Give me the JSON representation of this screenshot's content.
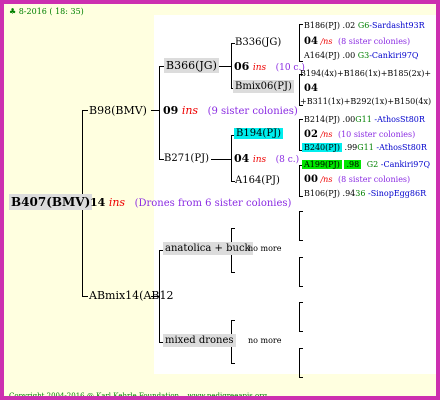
{
  "header": {
    "date": "8-2016 ( 18: 35)"
  },
  "footer": {
    "copyright": "Copyright 2004-2016 @ Karl Kehrle Foundation.",
    "url": "www.pedigreeapis.org"
  },
  "root": {
    "name": "B407(BMV)",
    "ins": "14",
    "ins_word": "ins",
    "drones_text": "(Drones from 6 sister colonies)"
  },
  "father": {
    "name": "B98(BMV)",
    "ins": "09",
    "ins_word": "ins",
    "sisters_text": "(9 sister colonies)"
  },
  "ff": {
    "name": "B366(JG)",
    "ins": "06",
    "ins_word": "ins",
    "sisters_text": "(10 c.)"
  },
  "fff": {
    "name": "B336(JG)"
  },
  "ffm": {
    "name": "Bmix06(PJ)"
  },
  "fm": {
    "name": "B271(PJ)",
    "ins": "04",
    "ins_word": "ins",
    "sisters_text": "(8 c.)"
  },
  "fmf": {
    "name": "B194(PJ)"
  },
  "fmm": {
    "name": "A164(PJ)"
  },
  "mother": {
    "name": "ABmix14(AB12"
  },
  "mf": {
    "name": "anatolica + buck",
    "note": "no more"
  },
  "mm": {
    "name": "mixed drones",
    "note": "no more"
  },
  "g4": [
    {
      "name": "B186(PJ)",
      "val": ".02",
      "code": "G6",
      "place": "-Sardasht93R"
    },
    {
      "ins": "04",
      "ins_word": "/ns",
      "text": "(8 sister colonies)"
    },
    {
      "name": "A164(PJ)",
      "val": ".00",
      "code": "G3",
      "place": "-Cankiri97Q"
    },
    {
      "text": "B194(4x)+B186(1x)+B185(2x)+"
    },
    {
      "ins": "04"
    },
    {
      "text": "+B311(1x)+B292(1x)+B150(4x)"
    },
    {
      "name": "B214(PJ)",
      "val": ".00",
      "code": "G11",
      "place": "-AthosSt80R"
    },
    {
      "ins": "02",
      "ins_word": "/ns",
      "text": "(10 sister colonies)"
    },
    {
      "name": "B240(PJ)",
      "val": ".99",
      "code": "G11",
      "place": "-AthosSt80R"
    },
    {
      "name": "A199(PJ)",
      "val": ".98",
      "code": "G2",
      "place": "-Cankiri97Q"
    },
    {
      "ins": "00",
      "ins_word": "/ns",
      "text": "(8 sister colonies)"
    },
    {
      "name": "B106(PJ)",
      "val": ".94",
      "code": "36",
      "place": "-SinopEgg86R"
    }
  ]
}
